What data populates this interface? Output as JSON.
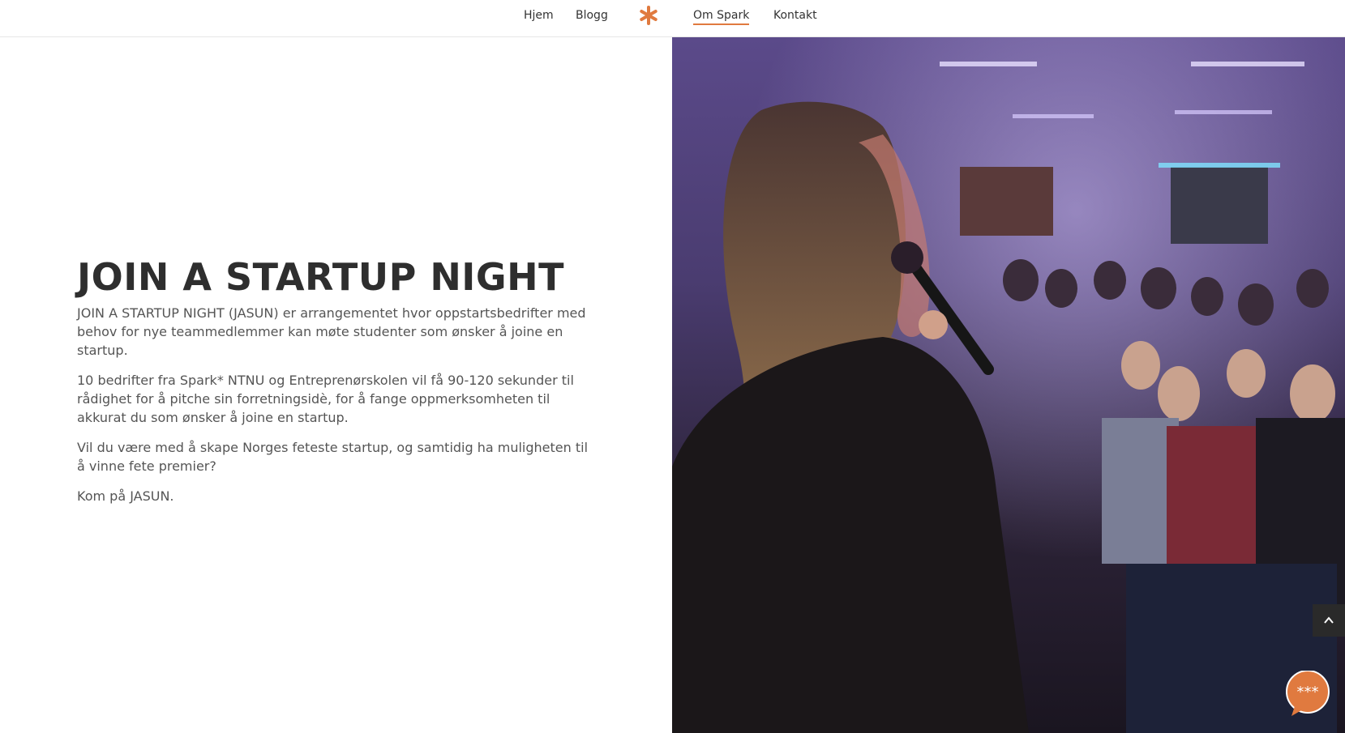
{
  "nav": {
    "items": [
      "Hjem",
      "Blogg",
      "Om Spark",
      "Kontakt"
    ],
    "active": "Om Spark",
    "logo_icon": "asterisk-icon",
    "accent": "#e07a3f"
  },
  "hero": {
    "title": "JOIN A STARTUP NIGHT",
    "paragraphs": [
      "JOIN A STARTUP NIGHT (JASUN) er arrangementet hvor oppstartsbedrifter med behov for nye teammedlemmer kan møte studenter som ønsker å joine en startup.",
      "10 bedrifter fra Spark* NTNU og Entreprenørskolen vil få 90-120 sekunder til rådighet for å pitche sin forretningsidè, for å fange oppmerksomheten til akkurat du som ønsker å joine en startup.",
      "Vil du være med å skape Norges feteste startup, og samtidig ha muligheten til å vinne fete premier?",
      "Kom på JASUN."
    ]
  },
  "photo": {
    "icon": "event-photo"
  },
  "widgets": {
    "scroll_top_icon": "chevron-up-icon",
    "chat_icon": "chat-bubble-icon",
    "chat_color": "#e07a3f"
  }
}
